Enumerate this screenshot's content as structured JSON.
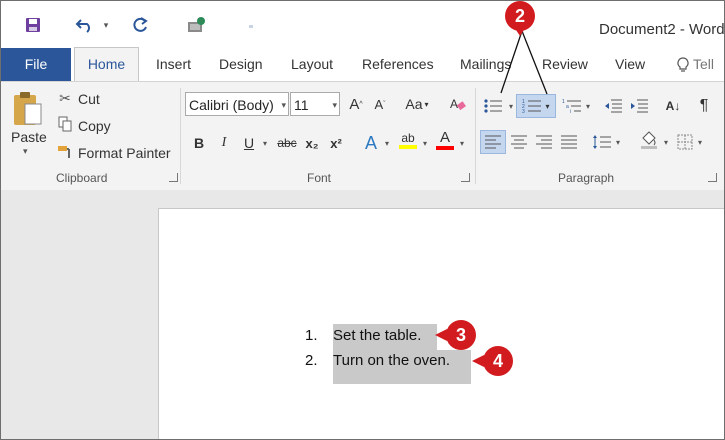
{
  "window": {
    "title": "Document2 - Word"
  },
  "quick_access": {
    "save_icon": "save-icon",
    "undo_icon": "undo-icon",
    "redo_icon": "redo-icon",
    "touch_icon": "touch-mode-icon",
    "customize_icon": "customize-qat-icon"
  },
  "tabs": [
    {
      "label": "File"
    },
    {
      "label": "Home"
    },
    {
      "label": "Insert"
    },
    {
      "label": "Design"
    },
    {
      "label": "Layout"
    },
    {
      "label": "References"
    },
    {
      "label": "Mailings"
    },
    {
      "label": "Review"
    },
    {
      "label": "View"
    },
    {
      "label": "Tell"
    }
  ],
  "clipboard": {
    "paste": "Paste",
    "cut": "Cut",
    "copy": "Copy",
    "format_painter": "Format Painter",
    "group_label": "Clipboard"
  },
  "font": {
    "family": "Calibri (Body)",
    "size": "11",
    "change_case": "Aa",
    "bold": "B",
    "italic": "I",
    "underline": "U",
    "strike": "abc",
    "subscript": "x₂",
    "superscript": "x²",
    "text_effects": "A",
    "highlight": "ab",
    "font_color": "A",
    "group_label": "Font"
  },
  "paragraph": {
    "sort": "A↓",
    "show_marks": "¶",
    "group_label": "Paragraph"
  },
  "document": {
    "items": [
      {
        "number": "1.",
        "text": "Set the table."
      },
      {
        "number": "2.",
        "text": "Turn on the oven."
      }
    ]
  },
  "callouts": [
    {
      "number": "2"
    },
    {
      "number": "3"
    },
    {
      "number": "4"
    }
  ],
  "colors": {
    "accent": "#2b579a",
    "callout": "#d21b1f",
    "selection": "#c9c9c9",
    "highlight_bar": "#ffff00",
    "font_color_bar": "#ff0000"
  }
}
